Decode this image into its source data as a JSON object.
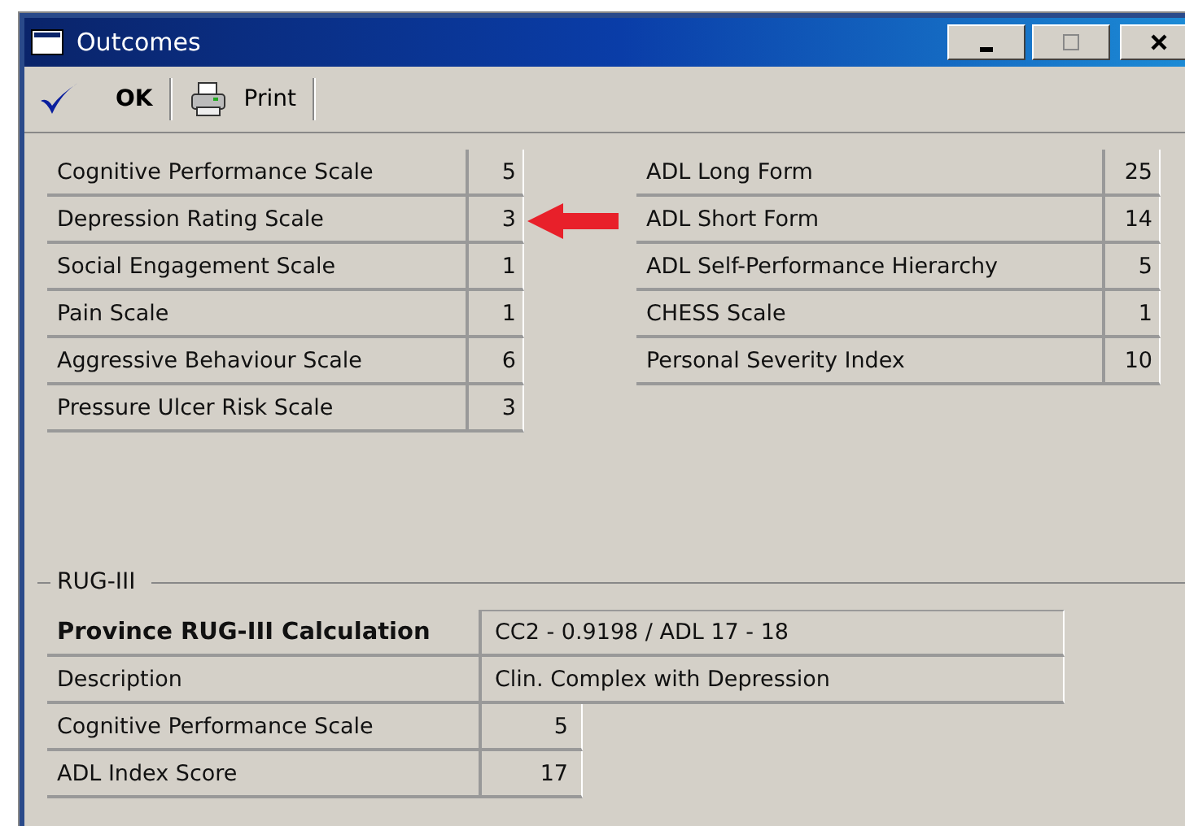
{
  "window": {
    "title": "Outcomes"
  },
  "toolbar": [
    {
      "kind": "check",
      "label": "OK"
    },
    {
      "kind": "print",
      "label": "Print"
    }
  ],
  "scales_left": [
    {
      "label": "Cognitive Performance Scale",
      "value": "5",
      "marked": false
    },
    {
      "label": "Depression Rating Scale",
      "value": "3",
      "marked": true
    },
    {
      "label": "Social Engagement Scale",
      "value": "1",
      "marked": false
    },
    {
      "label": "Pain Scale",
      "value": "1",
      "marked": false
    },
    {
      "label": "Aggressive Behaviour Scale",
      "value": "6",
      "marked": false
    },
    {
      "label": "Pressure Ulcer Risk Scale",
      "value": "3",
      "marked": false
    }
  ],
  "scales_right": [
    {
      "label": "ADL Long Form",
      "value": "25"
    },
    {
      "label": "ADL Short Form",
      "value": "14"
    },
    {
      "label": "ADL Self-Performance Hierarchy",
      "value": "5"
    },
    {
      "label": "CHESS Scale",
      "value": "1"
    },
    {
      "label": "Personal Severity Index",
      "value": "10"
    }
  ],
  "rug": {
    "title": "RUG-III",
    "rows": [
      {
        "kind": "heading",
        "label": "Province RUG-III Calculation",
        "value": "CC2 - 0.9198 / ADL 17 - 18"
      },
      {
        "kind": "text",
        "label": "Description",
        "value": "Clin. Complex with Depression"
      },
      {
        "kind": "score",
        "label": "Cognitive Performance Scale",
        "value": "5"
      },
      {
        "kind": "score",
        "label": "ADL Index Score",
        "value": "17"
      }
    ]
  }
}
